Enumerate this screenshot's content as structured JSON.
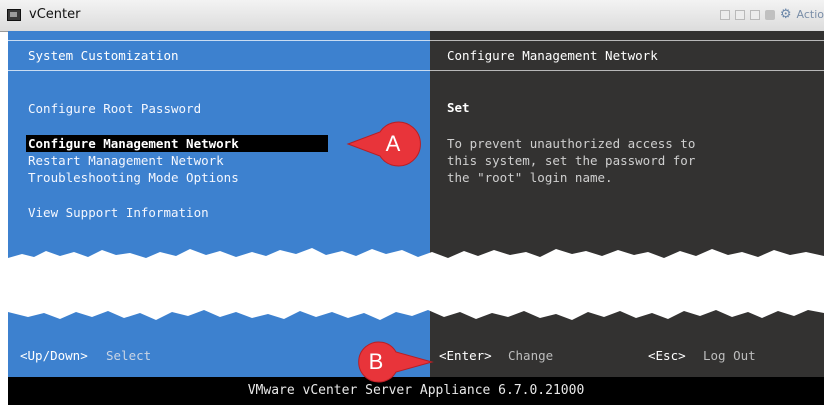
{
  "window": {
    "title": "vCenter",
    "actions_label": "Actio"
  },
  "left_panel": {
    "header": "System Customization",
    "menu": [
      {
        "label": "Configure Root Password",
        "selected": false
      },
      {
        "label": "Configure Management Network",
        "selected": true
      },
      {
        "label": "Restart Management Network",
        "selected": false
      },
      {
        "label": "Troubleshooting Mode Options",
        "selected": false
      },
      {
        "label": "View Support Information",
        "selected": false
      }
    ],
    "footer": {
      "key": "<Up/Down>",
      "action": "Select"
    }
  },
  "right_panel": {
    "header": "Configure Management Network",
    "set_label": "Set",
    "description": "To prevent unauthorized access to\nthis system, set the password for\nthe \"root\" login name.",
    "footer": [
      {
        "key": "<Enter>",
        "action": "Change"
      },
      {
        "key": "<Esc>",
        "action": "Log Out"
      }
    ]
  },
  "status_bar": "VMware vCenter Server Appliance 6.7.0.21000",
  "callouts": [
    {
      "label": "A",
      "color": "#e8343a"
    },
    {
      "label": "B",
      "color": "#e8343a"
    }
  ],
  "colors": {
    "console_blue": "#3d81cf",
    "console_dark": "#333231",
    "selection": "#000000"
  }
}
